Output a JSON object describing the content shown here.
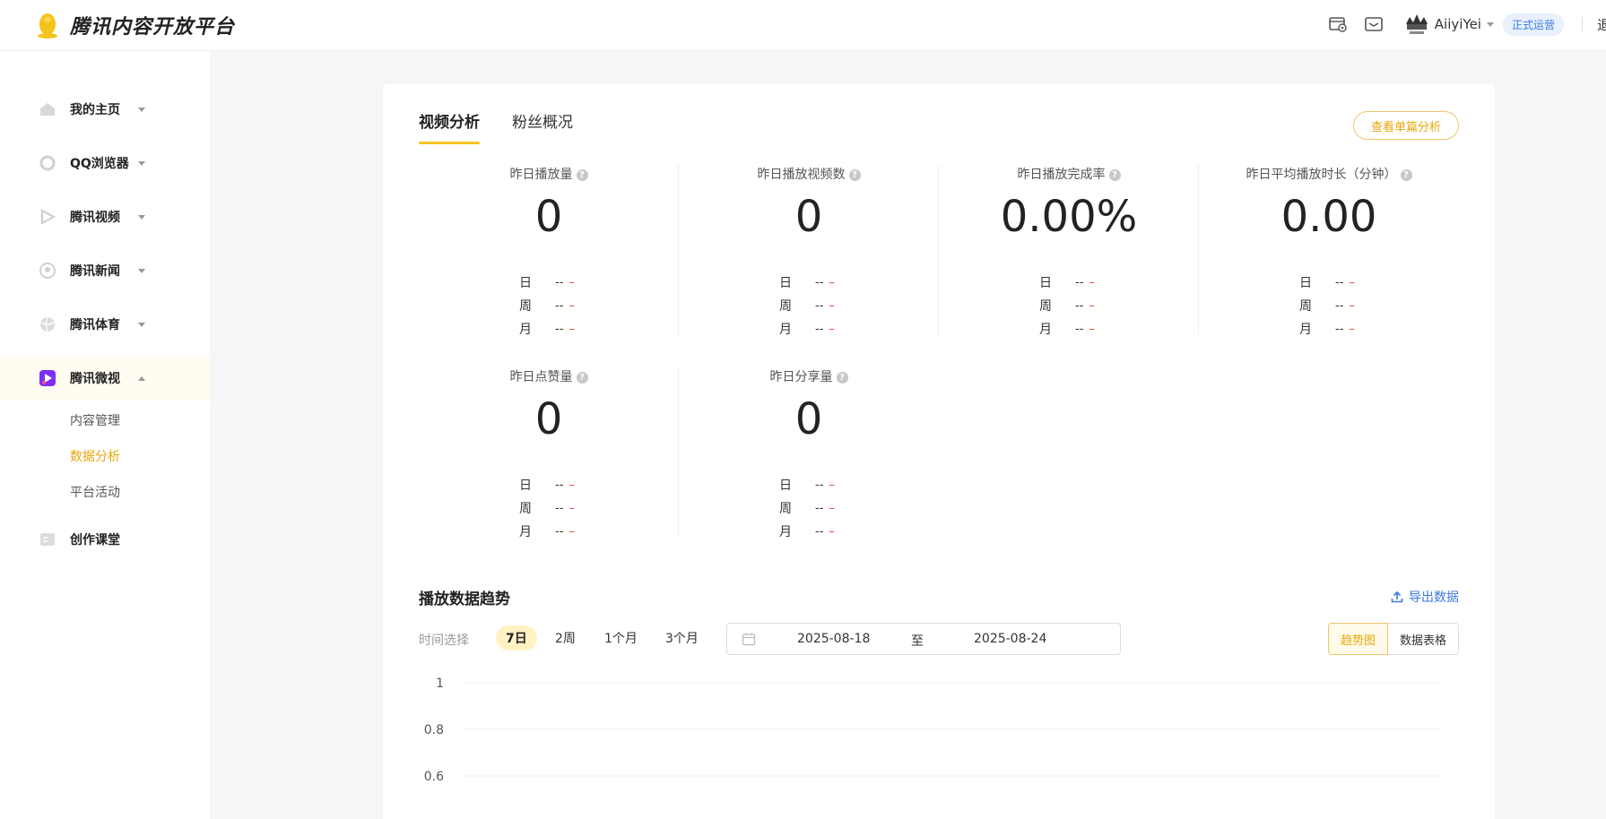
{
  "header": {
    "logo_text": "腾讯内容开放平台",
    "username": "AiiyiYei",
    "status_badge": "正式运营",
    "exit_label": "退出",
    "icons": [
      "studio-icon",
      "mail-icon"
    ]
  },
  "sidebar": {
    "items": [
      {
        "label": "我的主页",
        "icon": "home-icon",
        "expanded": false
      },
      {
        "label": "QQ浏览器",
        "icon": "browser-icon",
        "expanded": false
      },
      {
        "label": "腾讯视频",
        "icon": "video-icon",
        "expanded": false
      },
      {
        "label": "腾讯新闻",
        "icon": "news-icon",
        "expanded": false
      },
      {
        "label": "腾讯体育",
        "icon": "sports-icon",
        "expanded": false
      },
      {
        "label": "腾讯微视",
        "icon": "weishi-icon",
        "expanded": true
      },
      {
        "label": "创作课堂",
        "icon": "classroom-icon",
        "expanded": false
      }
    ],
    "sub_items": [
      {
        "label": "内容管理",
        "active": false
      },
      {
        "label": "数据分析",
        "active": true
      },
      {
        "label": "平台活动",
        "active": false
      }
    ]
  },
  "main": {
    "tabs": [
      {
        "label": "视频分析",
        "active": true
      },
      {
        "label": "粉丝概况",
        "active": false
      }
    ],
    "single_analysis_button": "查看单篇分析",
    "metrics": [
      {
        "label": "昨日播放量",
        "value": "0",
        "rows": [
          {
            "k": "日",
            "v": "--"
          },
          {
            "k": "周",
            "v": "--"
          },
          {
            "k": "月",
            "v": "--"
          }
        ]
      },
      {
        "label": "昨日播放视频数",
        "value": "0",
        "rows": [
          {
            "k": "日",
            "v": "--"
          },
          {
            "k": "周",
            "v": "--"
          },
          {
            "k": "月",
            "v": "--"
          }
        ]
      },
      {
        "label": "昨日播放完成率",
        "value": "0.00%",
        "rows": [
          {
            "k": "日",
            "v": "--"
          },
          {
            "k": "周",
            "v": "--"
          },
          {
            "k": "月",
            "v": "--"
          }
        ]
      },
      {
        "label": "昨日平均播放时长（分钟）",
        "value": "0.00",
        "rows": [
          {
            "k": "日",
            "v": "--"
          },
          {
            "k": "周",
            "v": "--"
          },
          {
            "k": "月",
            "v": "--"
          }
        ]
      },
      {
        "label": "昨日点赞量",
        "value": "0",
        "rows": [
          {
            "k": "日",
            "v": "--"
          },
          {
            "k": "周",
            "v": "--"
          },
          {
            "k": "月",
            "v": "--"
          }
        ]
      },
      {
        "label": "昨日分享量",
        "value": "0",
        "rows": [
          {
            "k": "日",
            "v": "--"
          },
          {
            "k": "周",
            "v": "--"
          },
          {
            "k": "月",
            "v": "--"
          }
        ]
      }
    ],
    "trend_indicator": "–",
    "help_glyph": "?",
    "trend": {
      "title": "播放数据趋势",
      "export_label": "导出数据",
      "time_label": "时间选择",
      "ranges": [
        {
          "label": "7日",
          "active": true
        },
        {
          "label": "2周",
          "active": false
        },
        {
          "label": "1个月",
          "active": false
        },
        {
          "label": "3个月",
          "active": false
        }
      ],
      "date_start": "2025-08-18",
      "date_sep": "至",
      "date_end": "2025-08-24",
      "views": [
        {
          "label": "趋势图",
          "active": true
        },
        {
          "label": "数据表格",
          "active": false
        }
      ]
    }
  },
  "chart_data": {
    "type": "line",
    "y_ticks": [
      "1",
      "0.8",
      "0.6"
    ],
    "ylim": [
      0,
      1
    ],
    "grid": true,
    "colors": {
      "accent": "#f6c31b",
      "link": "#3a7be0",
      "trend_down": "#e04a3a"
    }
  }
}
